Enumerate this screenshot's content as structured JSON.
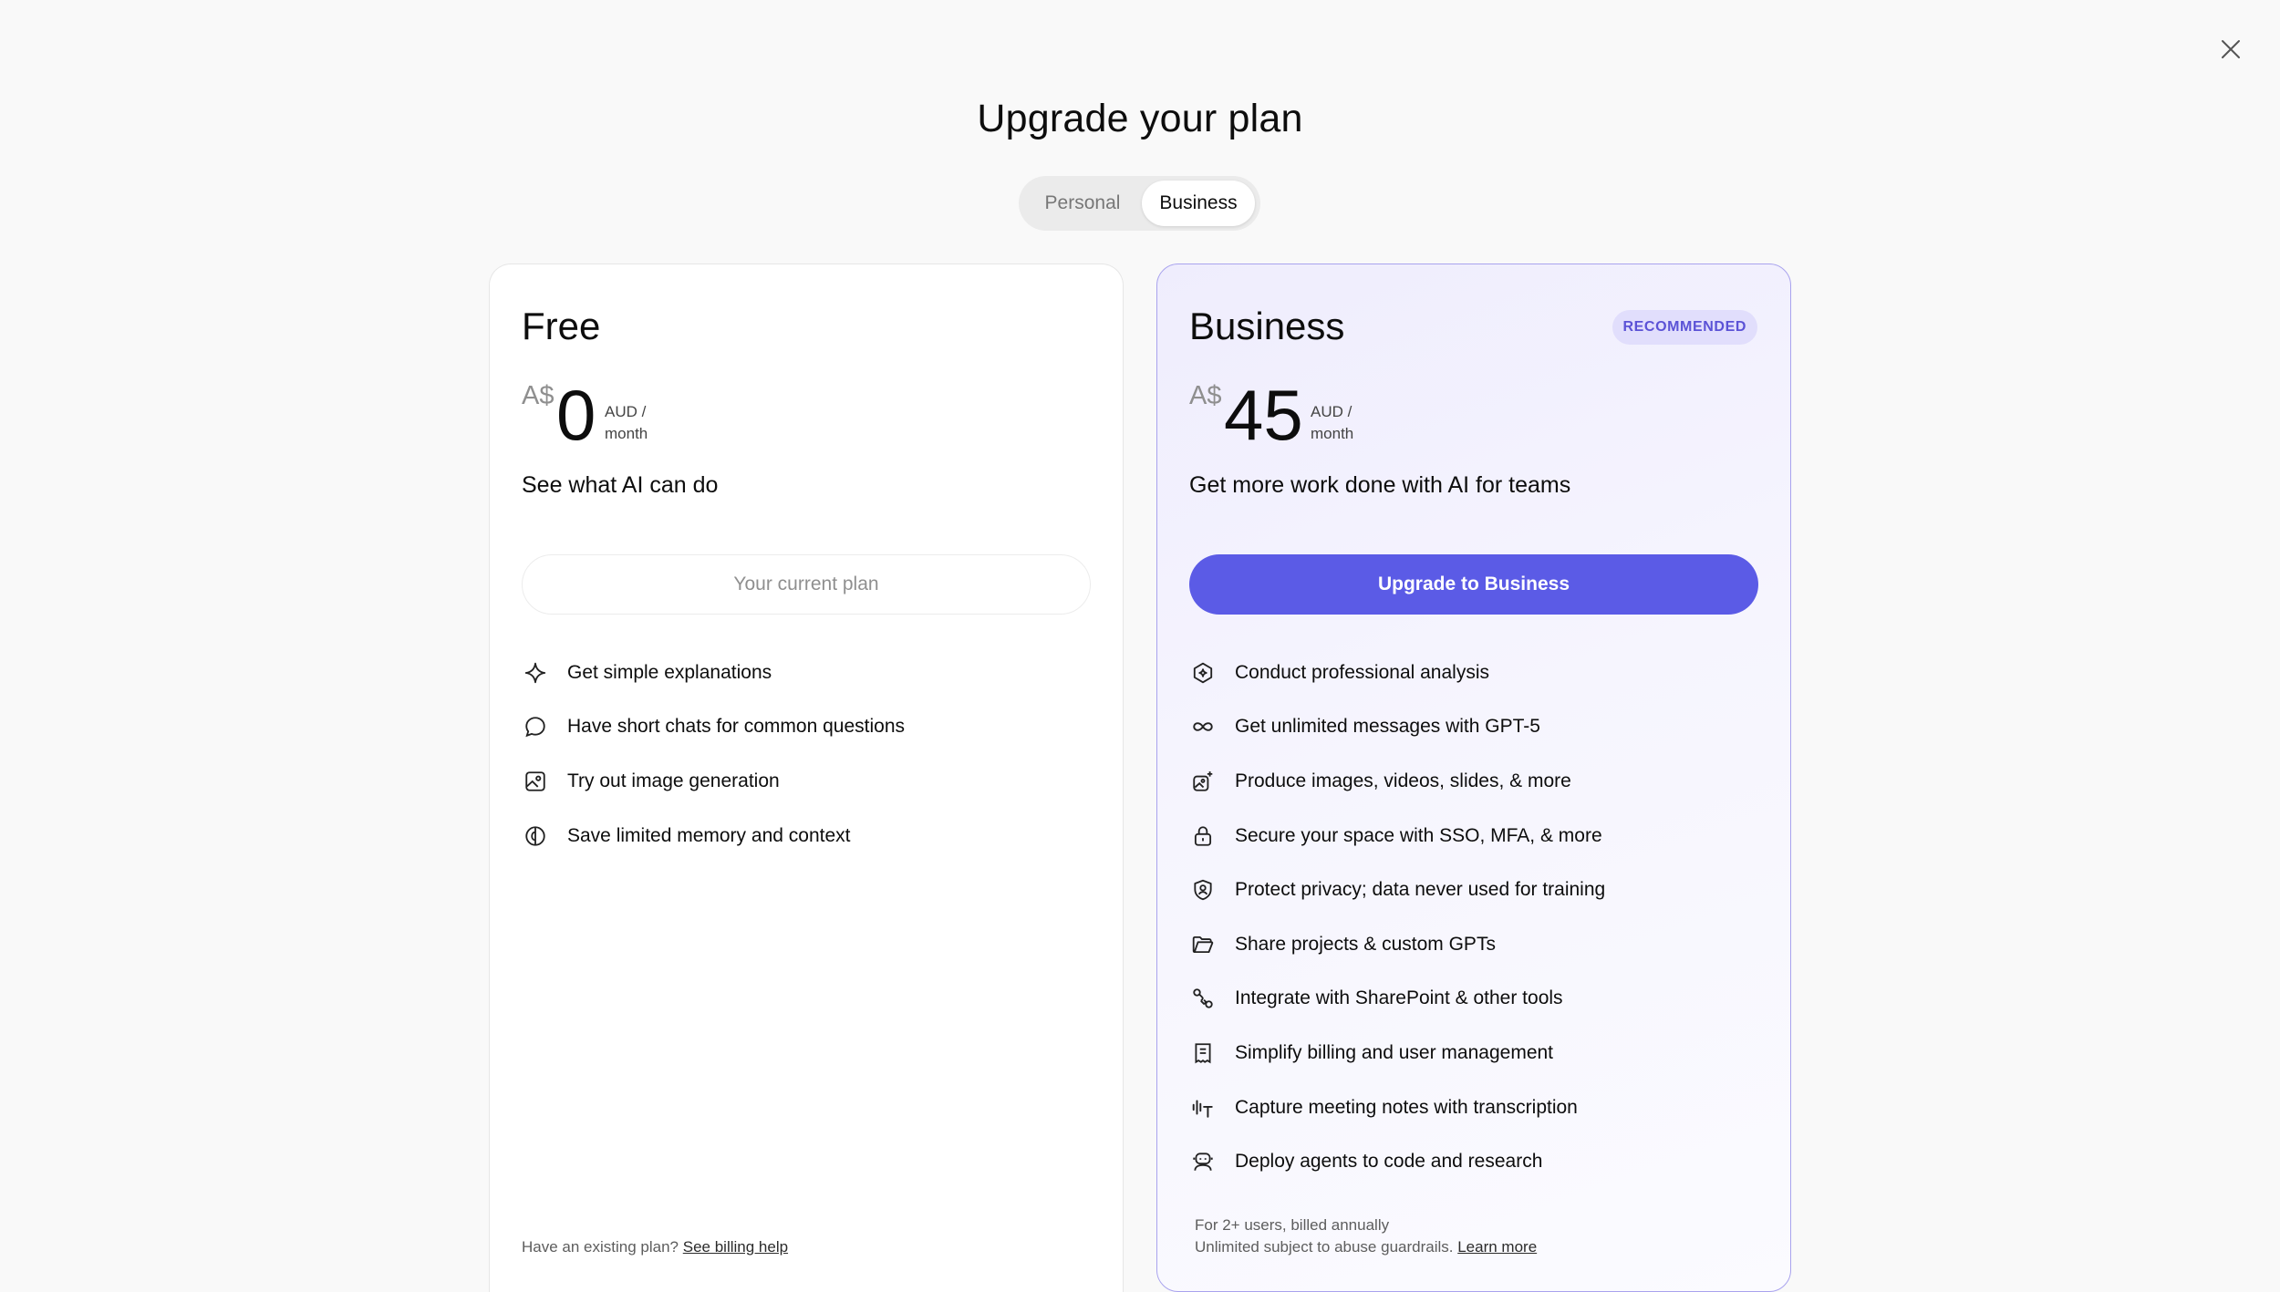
{
  "header": {
    "title": "Upgrade your plan",
    "toggle": {
      "personal": "Personal",
      "business": "Business",
      "selected": "Business"
    }
  },
  "free": {
    "name": "Free",
    "currency": "A$",
    "amount": "0",
    "period_line1": "AUD /",
    "period_line2": "month",
    "tagline": "See what AI can do",
    "button": "Your current plan",
    "features": [
      {
        "icon": "sparkle-icon",
        "label": "Get simple explanations"
      },
      {
        "icon": "chat-bubble-icon",
        "label": "Have short chats for common questions"
      },
      {
        "icon": "image-icon",
        "label": "Try out image generation"
      },
      {
        "icon": "brain-icon",
        "label": "Save limited memory and context"
      }
    ],
    "footnote_text": "Have an existing plan?",
    "footnote_link": "See billing help"
  },
  "business": {
    "name": "Business",
    "badge": "RECOMMENDED",
    "currency": "A$",
    "amount": "45",
    "period_line1": "AUD /",
    "period_line2": "month",
    "tagline": "Get more work done with AI for teams",
    "button": "Upgrade to Business",
    "features": [
      {
        "icon": "analysis-icon",
        "label": "Conduct professional analysis"
      },
      {
        "icon": "infinity-icon",
        "label": "Get unlimited messages with GPT-5"
      },
      {
        "icon": "media-create-icon",
        "label": "Produce images, videos, slides, & more"
      },
      {
        "icon": "lock-icon",
        "label": "Secure your space with SSO, MFA, & more"
      },
      {
        "icon": "shield-user-icon",
        "label": "Protect privacy; data never used for training"
      },
      {
        "icon": "folder-icon",
        "label": "Share projects & custom GPTs"
      },
      {
        "icon": "connector-icon",
        "label": "Integrate with SharePoint & other tools"
      },
      {
        "icon": "receipt-icon",
        "label": "Simplify billing and user management"
      },
      {
        "icon": "transcription-icon",
        "label": "Capture meeting notes with transcription"
      },
      {
        "icon": "robot-icon",
        "label": "Deploy agents to code and research"
      }
    ],
    "footnote_line1": "For 2+ users, billed annually",
    "footnote_line2": "Unlimited subject to abuse guardrails.",
    "footnote_link": "Learn more"
  },
  "colors": {
    "accent": "#5b5be6",
    "badge_bg": "#e1defc",
    "badge_text": "#5b52d6",
    "background": "#f9f9f9"
  }
}
